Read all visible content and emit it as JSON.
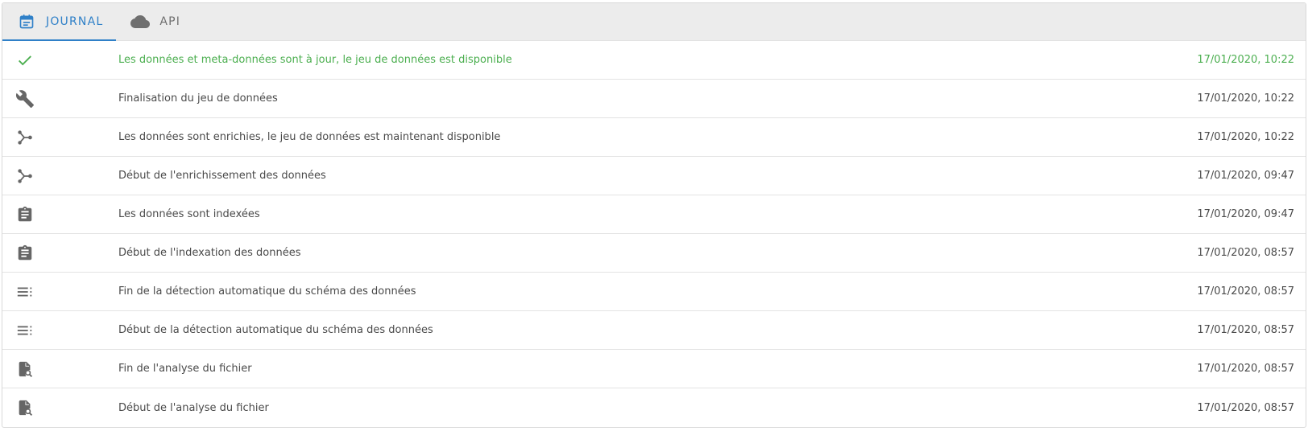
{
  "tabs": [
    {
      "label": "JOURNAL",
      "icon": "calendar-icon",
      "active": true
    },
    {
      "label": "API",
      "icon": "cloud-icon",
      "active": false
    }
  ],
  "colors": {
    "accent": "#2f80c8",
    "success": "#4caf50",
    "icon_gray": "#666666",
    "tabbar_bg": "#ececec"
  },
  "journal": {
    "entries": [
      {
        "icon": "check-icon",
        "status": "success",
        "text": "Les données et meta-données sont à jour, le jeu de données est disponible",
        "date": "17/01/2020, 10:22"
      },
      {
        "icon": "wrench-icon",
        "text": "Finalisation du jeu de données",
        "date": "17/01/2020, 10:22"
      },
      {
        "icon": "merge-icon",
        "text": "Les données sont enrichies, le jeu de données est maintenant disponible",
        "date": "17/01/2020, 10:22"
      },
      {
        "icon": "merge-icon",
        "text": "Début de l'enrichissement des données",
        "date": "17/01/2020, 09:47"
      },
      {
        "icon": "clipboard-icon",
        "text": "Les données sont indexées",
        "date": "17/01/2020, 09:47"
      },
      {
        "icon": "clipboard-icon",
        "text": "Début de l'indexation des données",
        "date": "17/01/2020, 08:57"
      },
      {
        "icon": "list-icon",
        "text": "Fin de la détection automatique du schéma des données",
        "date": "17/01/2020, 08:57"
      },
      {
        "icon": "list-icon",
        "text": "Début de la détection automatique du schéma des données",
        "date": "17/01/2020, 08:57"
      },
      {
        "icon": "file-search-icon",
        "text": "Fin de l'analyse du fichier",
        "date": "17/01/2020, 08:57"
      },
      {
        "icon": "file-search-icon",
        "text": "Début de l'analyse du fichier",
        "date": "17/01/2020, 08:57"
      }
    ]
  }
}
